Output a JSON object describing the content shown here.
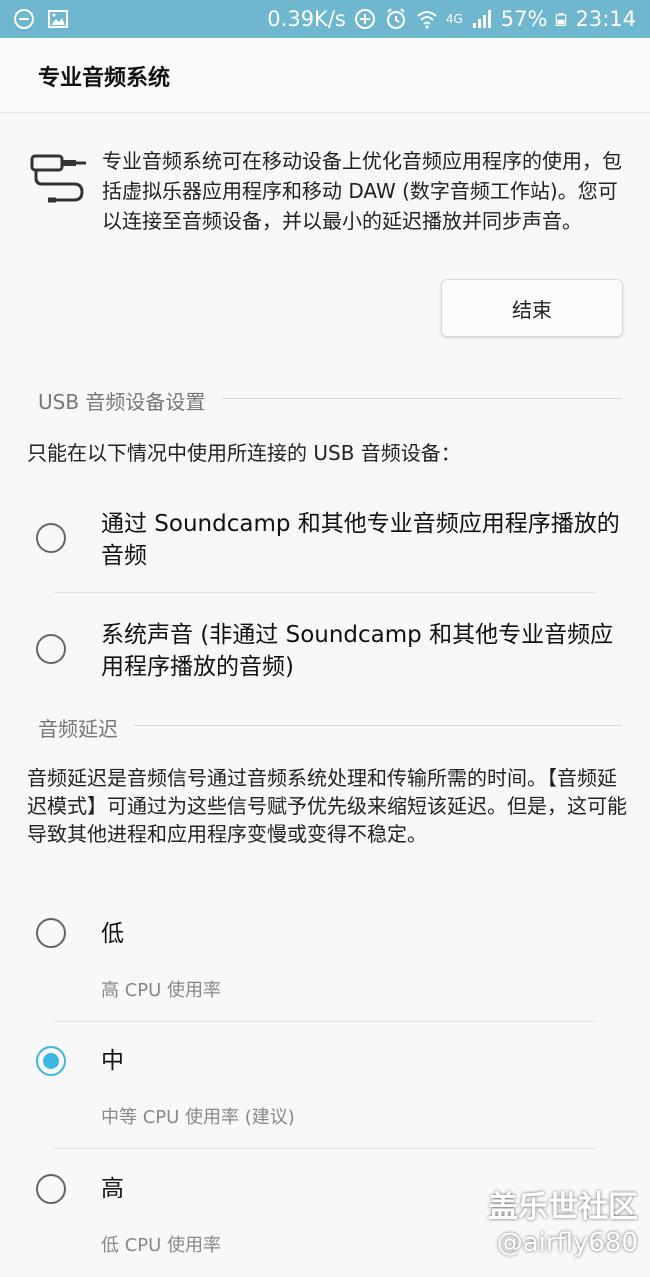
{
  "status_bar": {
    "speed": "0.39K/s",
    "network": "4G",
    "battery": "57%",
    "time": "23:14",
    "color": "#6fb6cf"
  },
  "header": {
    "title": "专业音频系统"
  },
  "intro": {
    "text": "专业音频系统可在移动设备上优化音频应用程序的使用，包括虚拟乐器应用程序和移动 DAW (数字音频工作站)。您可以连接至音频设备，并以最小的延迟播放并同步声音。",
    "end_button": "结束"
  },
  "usb_section": {
    "header": "USB 音频设备设置",
    "description": "只能在以下情况中使用所连接的 USB 音频设备：",
    "options": [
      {
        "label": "通过 Soundcamp 和其他专业音频应用程序播放的音频",
        "checked": false
      },
      {
        "label": "系统声音 (非通过 Soundcamp 和其他专业音频应用程序播放的音频)",
        "checked": false
      }
    ]
  },
  "latency_section": {
    "header": "音频延迟",
    "description": "音频延迟是音频信号通过音频系统处理和传输所需的时间。【音频延迟模式】可通过为这些信号赋予优先级来缩短该延迟。但是，这可能导致其他进程和应用程序变慢或变得不稳定。",
    "options": [
      {
        "label": "低",
        "sub": "高 CPU 使用率",
        "checked": false
      },
      {
        "label": "中",
        "sub": "中等 CPU 使用率 (建议)",
        "checked": true
      },
      {
        "label": "高",
        "sub": "低 CPU 使用率",
        "checked": false
      }
    ]
  },
  "watermark": {
    "line1": "盖乐世社区",
    "line2": "@airfly680"
  },
  "accent_color": "#3db6e3"
}
